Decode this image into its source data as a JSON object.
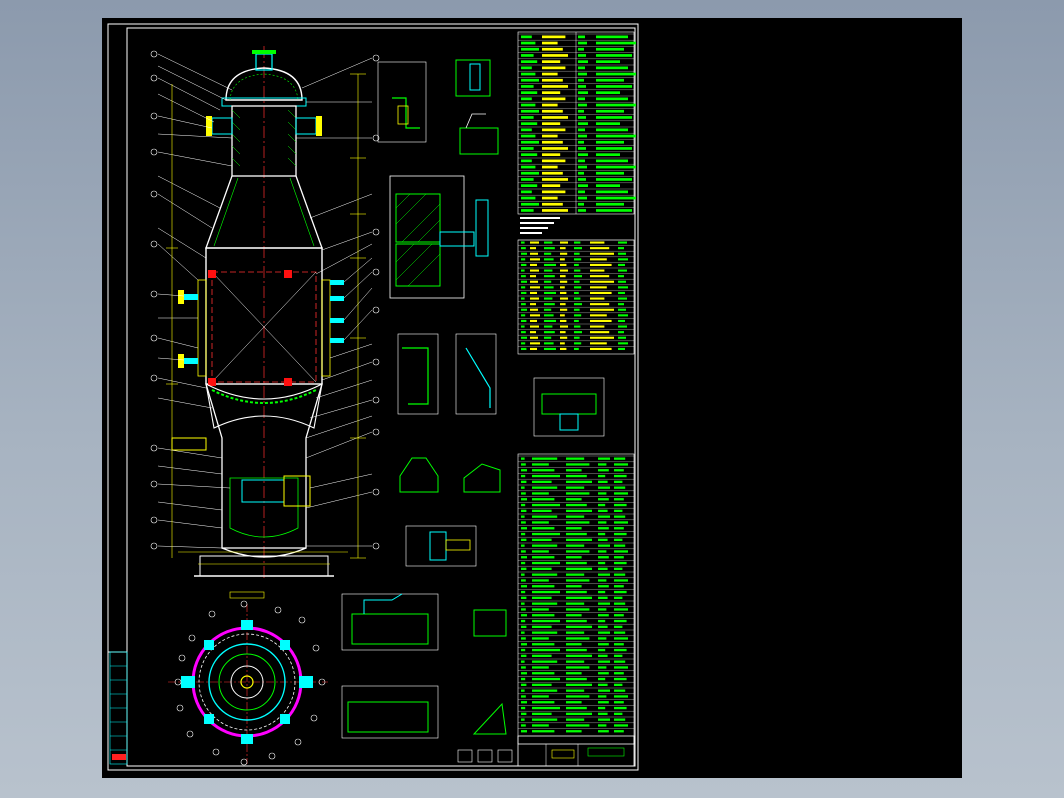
{
  "drawing": {
    "sheet_label": "",
    "notes_heading": "",
    "title_block": {
      "drawing_name": "",
      "drawing_number": ""
    }
  },
  "colors": {
    "background": "#000000",
    "frame": "#ffffff",
    "outline": "#ffffff",
    "dimension": "#ffff00",
    "hatch": "#00ff00",
    "centerline": "#ff3030",
    "nozzle": "#00ffff",
    "flange_ring": "#ff00ff",
    "table_text": "#00ff00"
  },
  "icons": {
    "sheet": "cad-drawing-sheet",
    "main_view": "reactor-vessel-section",
    "top_view": "flange-top-view"
  }
}
